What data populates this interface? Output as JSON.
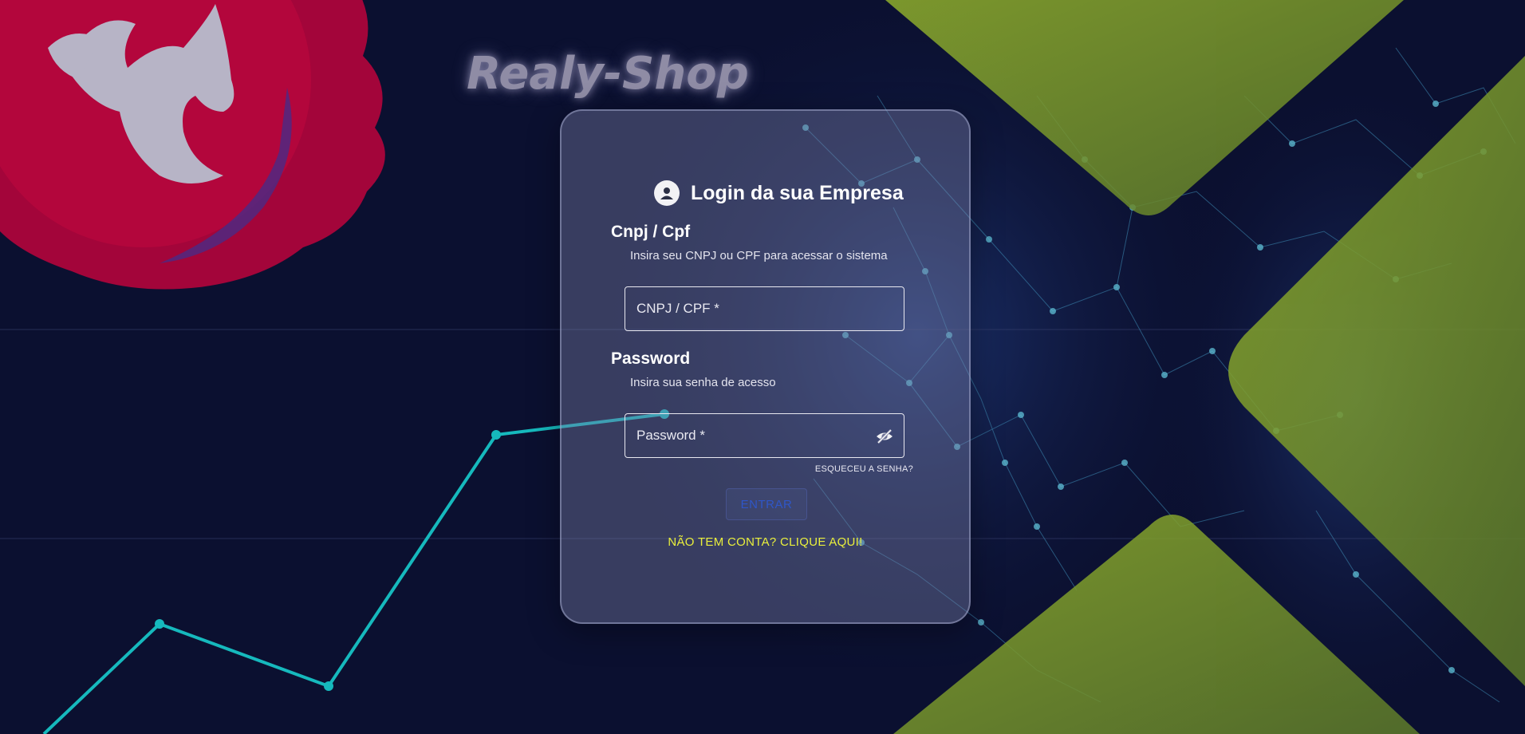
{
  "brand": {
    "name": "Realy-Shop",
    "logo": "pegasus-logo"
  },
  "login_card": {
    "title": "Login da sua Empresa",
    "title_icon": "account-circle-icon",
    "cnpj_section": {
      "title": "Cnpj / Cpf",
      "subtitle": "Insira seu CNPJ ou CPF para acessar o sistema",
      "field_label": "CNPJ / CPF *",
      "value": ""
    },
    "password_section": {
      "title": "Password",
      "subtitle": "Insira sua senha de acesso",
      "field_label": "Password *",
      "value": "",
      "visibility_icon": "eye-off-icon"
    },
    "forgot_link": "ESQUECEU A SENHA?",
    "submit_label": "ENTRAR",
    "signup_link": "NÃO TEM CONTA? CLIQUE AQUI!"
  },
  "colors": {
    "background": "#0b1030",
    "card": "#7a7fa8",
    "accent_link": "#e9ef3c",
    "button_text": "#2f56c8",
    "chart_line": "#16b9bd",
    "logo_red": "#b3063c",
    "shape_green": "#7f9a2c"
  }
}
